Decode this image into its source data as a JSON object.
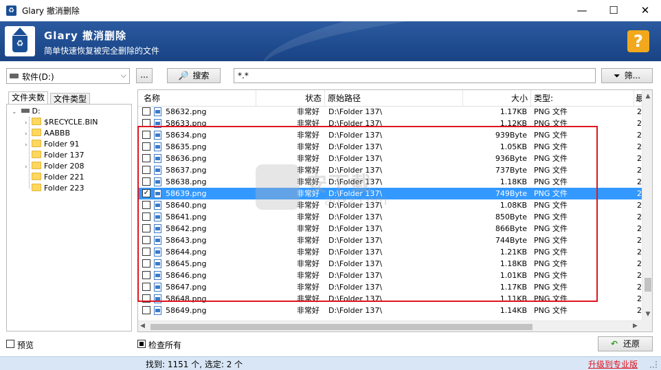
{
  "window": {
    "title": "Glary 撤消删除",
    "minimize": "—",
    "maximize": "☐",
    "close": "✕"
  },
  "header": {
    "title": "Glary 撤消删除",
    "subtitle": "简单快速恢复被完全删除的文件",
    "help": "?"
  },
  "toolbar": {
    "drive": "软件(D:)",
    "browse_label": "...",
    "search_label": "搜索",
    "pattern": "*.*",
    "filter_label": "筛..."
  },
  "left_panel": {
    "tabs": [
      "文件夹数",
      "文件类型"
    ],
    "root": "D:",
    "folders": [
      "$RECYCLE.BIN",
      "AABBB",
      "Folder 91",
      "Folder 137",
      "Folder 208",
      "Folder 221",
      "Folder 223"
    ]
  },
  "list": {
    "columns": [
      "名称",
      "状态",
      "原始路径",
      "大小",
      "类型:",
      "最"
    ],
    "rows": [
      {
        "name": "58632.png",
        "state": "非常好",
        "path": "D:\\Folder 137\\",
        "size": "1.17KB",
        "type": "PNG 文件",
        "extra": "2",
        "checked": false,
        "selected": false
      },
      {
        "name": "58633.png",
        "state": "非常好",
        "path": "D:\\Folder 137\\",
        "size": "1.12KB",
        "type": "PNG 文件",
        "extra": "2",
        "checked": false,
        "selected": false
      },
      {
        "name": "58634.png",
        "state": "非常好",
        "path": "D:\\Folder 137\\",
        "size": "939Byte",
        "type": "PNG 文件",
        "extra": "2",
        "checked": false,
        "selected": false
      },
      {
        "name": "58635.png",
        "state": "非常好",
        "path": "D:\\Folder 137\\",
        "size": "1.05KB",
        "type": "PNG 文件",
        "extra": "2",
        "checked": false,
        "selected": false
      },
      {
        "name": "58636.png",
        "state": "非常好",
        "path": "D:\\Folder 137\\",
        "size": "936Byte",
        "type": "PNG 文件",
        "extra": "2",
        "checked": false,
        "selected": false
      },
      {
        "name": "58637.png",
        "state": "非常好",
        "path": "D:\\Folder 137\\",
        "size": "737Byte",
        "type": "PNG 文件",
        "extra": "2",
        "checked": false,
        "selected": false
      },
      {
        "name": "58638.png",
        "state": "非常好",
        "path": "D:\\Folder 137\\",
        "size": "1.18KB",
        "type": "PNG 文件",
        "extra": "2",
        "checked": false,
        "selected": false
      },
      {
        "name": "58639.png",
        "state": "非常好",
        "path": "D:\\Folder 137\\",
        "size": "749Byte",
        "type": "PNG 文件",
        "extra": "2",
        "checked": true,
        "selected": true
      },
      {
        "name": "58640.png",
        "state": "非常好",
        "path": "D:\\Folder 137\\",
        "size": "1.08KB",
        "type": "PNG 文件",
        "extra": "2",
        "checked": false,
        "selected": false
      },
      {
        "name": "58641.png",
        "state": "非常好",
        "path": "D:\\Folder 137\\",
        "size": "850Byte",
        "type": "PNG 文件",
        "extra": "2",
        "checked": false,
        "selected": false
      },
      {
        "name": "58642.png",
        "state": "非常好",
        "path": "D:\\Folder 137\\",
        "size": "866Byte",
        "type": "PNG 文件",
        "extra": "2",
        "checked": false,
        "selected": false
      },
      {
        "name": "58643.png",
        "state": "非常好",
        "path": "D:\\Folder 137\\",
        "size": "744Byte",
        "type": "PNG 文件",
        "extra": "2",
        "checked": false,
        "selected": false
      },
      {
        "name": "58644.png",
        "state": "非常好",
        "path": "D:\\Folder 137\\",
        "size": "1.21KB",
        "type": "PNG 文件",
        "extra": "2",
        "checked": false,
        "selected": false
      },
      {
        "name": "58645.png",
        "state": "非常好",
        "path": "D:\\Folder 137\\",
        "size": "1.18KB",
        "type": "PNG 文件",
        "extra": "2",
        "checked": false,
        "selected": false
      },
      {
        "name": "58646.png",
        "state": "非常好",
        "path": "D:\\Folder 137\\",
        "size": "1.01KB",
        "type": "PNG 文件",
        "extra": "2",
        "checked": false,
        "selected": false
      },
      {
        "name": "58647.png",
        "state": "非常好",
        "path": "D:\\Folder 137\\",
        "size": "1.17KB",
        "type": "PNG 文件",
        "extra": "2",
        "checked": false,
        "selected": false
      },
      {
        "name": "58648.png",
        "state": "非常好",
        "path": "D:\\Folder 137\\",
        "size": "1.11KB",
        "type": "PNG 文件",
        "extra": "2",
        "checked": false,
        "selected": false
      },
      {
        "name": "58649.png",
        "state": "非常好",
        "path": "D:\\Folder 137\\",
        "size": "1.14KB",
        "type": "PNG 文件",
        "extra": "2",
        "checked": false,
        "selected": false
      }
    ]
  },
  "watermark": {
    "title": "安下载",
    "sub": "anxz.com"
  },
  "bottom": {
    "preview_label": "预览",
    "check_all_label": "检查所有",
    "restore_label": "还原"
  },
  "status": {
    "text": "找到: 1151 个, 选定: 2 个",
    "upgrade": "升级到专业版"
  },
  "colors": {
    "banner": "#1f4c8f",
    "selection": "#3399ff",
    "highlight": "#e0141e",
    "help": "#f2a81d"
  }
}
